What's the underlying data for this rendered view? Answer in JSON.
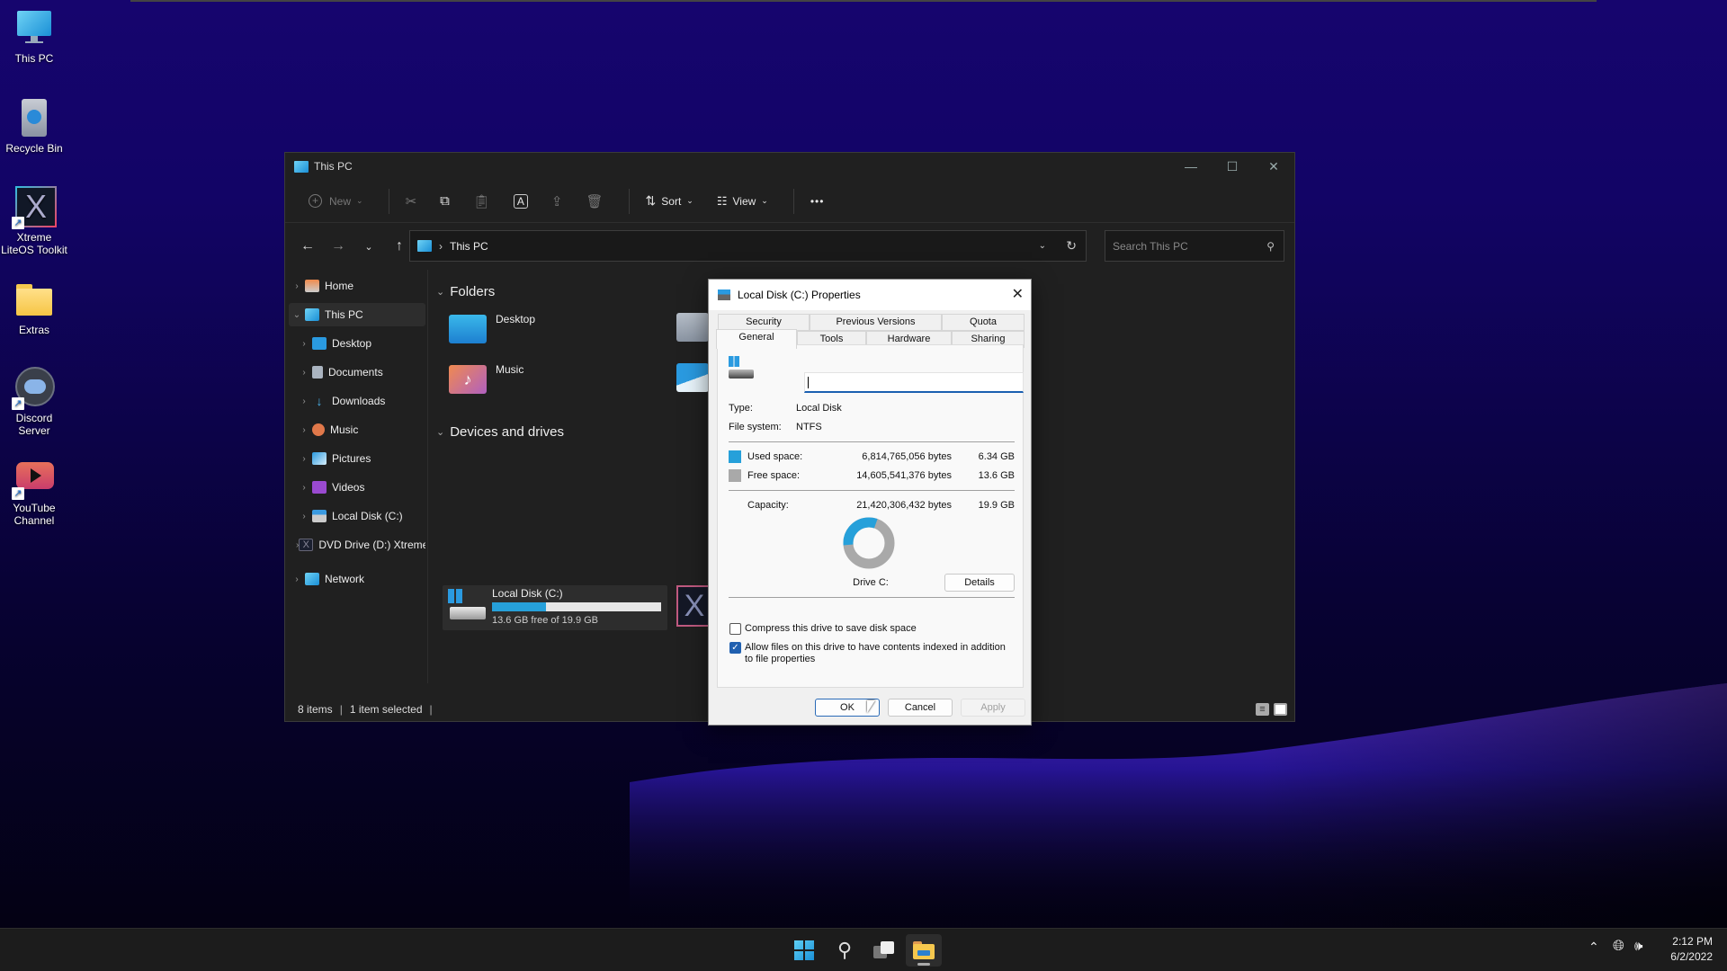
{
  "desktop": {
    "icons": [
      {
        "label": "This PC",
        "icon": "monitor-icon"
      },
      {
        "label": "Recycle Bin",
        "icon": "recycle-bin-icon"
      },
      {
        "label": "Xtreme LiteOS Toolkit",
        "icon": "xtreme-toolkit-icon",
        "shortcut": true
      },
      {
        "label": "Extras",
        "icon": "folder-icon"
      },
      {
        "label": "Discord Server",
        "icon": "discord-icon",
        "shortcut": true
      },
      {
        "label": "YouTube Channel",
        "icon": "youtube-icon",
        "shortcut": true
      }
    ]
  },
  "explorer": {
    "title": "This PC",
    "toolbar": {
      "new_label": "New",
      "sort_label": "Sort",
      "view_label": "View",
      "more_label": "•••"
    },
    "address": {
      "crumb": "This PC",
      "search_placeholder": "Search This PC"
    },
    "sidebar": {
      "items": [
        {
          "label": "Home",
          "icon": "home-icon"
        },
        {
          "label": "This PC",
          "icon": "monitor-icon",
          "selected": true,
          "expanded": true
        },
        {
          "label": "Desktop",
          "icon": "desktop-folder-icon"
        },
        {
          "label": "Documents",
          "icon": "documents-icon"
        },
        {
          "label": "Downloads",
          "icon": "downloads-icon"
        },
        {
          "label": "Music",
          "icon": "music-icon"
        },
        {
          "label": "Pictures",
          "icon": "pictures-icon"
        },
        {
          "label": "Videos",
          "icon": "videos-icon"
        },
        {
          "label": "Local Disk (C:)",
          "icon": "drive-icon"
        },
        {
          "label": "DVD Drive (D:) Xtreme",
          "icon": "dvd-drive-icon"
        },
        {
          "label": "Network",
          "icon": "network-icon"
        }
      ]
    },
    "content": {
      "folders_header": "Folders",
      "folders": [
        {
          "label": "Desktop",
          "icon": "desktop-folder-icon"
        },
        {
          "label": "Music",
          "icon": "music-folder-icon"
        }
      ],
      "devices_header": "Devices and drives",
      "drive": {
        "label": "Local Disk (C:)",
        "free_text": "13.6 GB free of 19.9 GB",
        "used_fraction": 0.318
      }
    },
    "status": {
      "items": "8 items",
      "selected": "1 item selected"
    }
  },
  "dialog": {
    "title": "Local Disk (C:) Properties",
    "tabs_row1": [
      "Security",
      "Previous Versions",
      "Quota"
    ],
    "tabs_row2": [
      "General",
      "Tools",
      "Hardware",
      "Sharing"
    ],
    "active_tab": "General",
    "name_value": "",
    "type_label": "Type:",
    "type_value": "Local Disk",
    "fs_label": "File system:",
    "fs_value": "NTFS",
    "used_label": "Used space:",
    "used_bytes": "6,814,765,056 bytes",
    "used_gb": "6.34 GB",
    "free_label": "Free space:",
    "free_bytes": "14,605,541,376 bytes",
    "free_gb": "13.6 GB",
    "capacity_label": "Capacity:",
    "capacity_bytes": "21,420,306,432 bytes",
    "capacity_gb": "19.9 GB",
    "used_fraction": 0.318,
    "drive_label": "Drive C:",
    "details_button": "Details",
    "compress_label": "Compress this drive to save disk space",
    "compress_checked": false,
    "index_label": "Allow files on this drive to have contents indexed in addition to file properties",
    "index_checked": true,
    "ok_button": "OK",
    "cancel_button": "Cancel",
    "apply_button": "Apply",
    "colors": {
      "used": "#26a0da",
      "free": "#a9a9a9"
    }
  },
  "taskbar": {
    "time": "2:12 PM",
    "date": "6/2/2022"
  }
}
